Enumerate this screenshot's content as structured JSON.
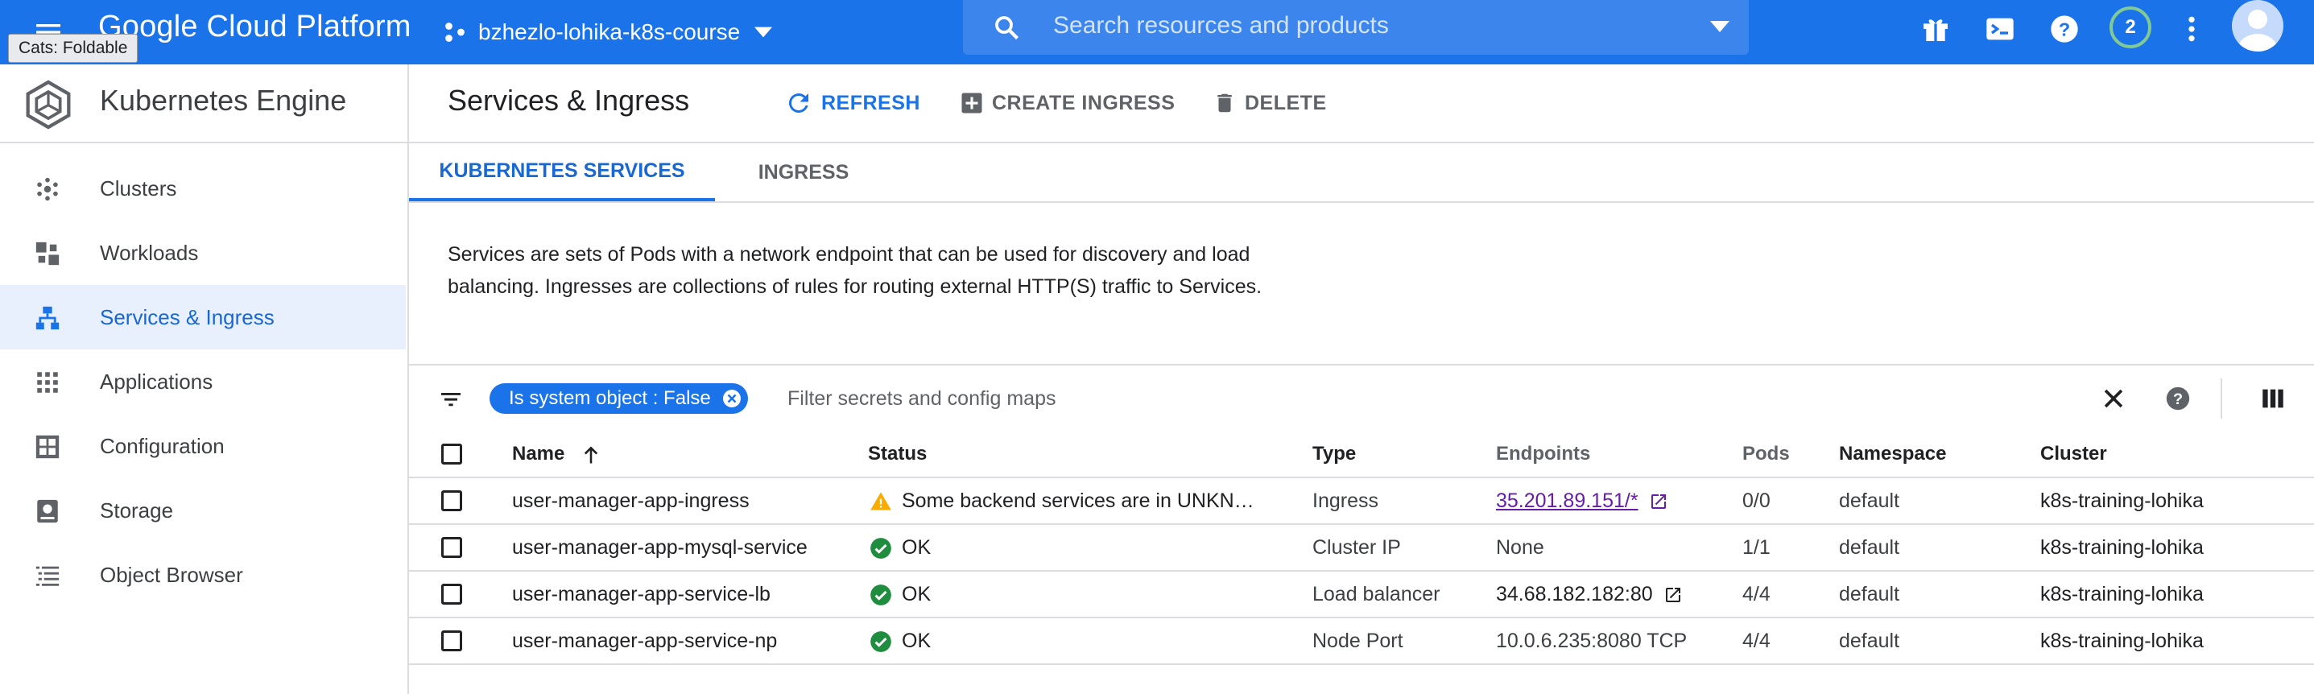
{
  "topbar": {
    "brand": "Google Cloud Platform",
    "project": "bzhezlo-lohika-k8s-course",
    "search_placeholder": "Search resources and products",
    "notification_count": "2",
    "tooltip": "Cats: Foldable",
    "icons": [
      "menu-icon",
      "project-icon",
      "search-icon",
      "gift-icon",
      "cloud-shell-icon",
      "help-icon",
      "more-vert-icon",
      "account-avatar"
    ]
  },
  "sidebar": {
    "product": "Kubernetes Engine",
    "items": [
      {
        "label": "Clusters",
        "icon": "clusters-icon"
      },
      {
        "label": "Workloads",
        "icon": "workloads-icon"
      },
      {
        "label": "Services & Ingress",
        "icon": "services-icon",
        "active": true
      },
      {
        "label": "Applications",
        "icon": "applications-icon"
      },
      {
        "label": "Configuration",
        "icon": "configuration-icon"
      },
      {
        "label": "Storage",
        "icon": "storage-icon"
      },
      {
        "label": "Object Browser",
        "icon": "object-browser-icon"
      }
    ]
  },
  "main": {
    "title": "Services & Ingress",
    "actions": {
      "refresh": "REFRESH",
      "create": "CREATE INGRESS",
      "delete": "DELETE"
    },
    "tabs": [
      {
        "label": "KUBERNETES SERVICES",
        "active": true
      },
      {
        "label": "INGRESS"
      }
    ],
    "description": "Services are sets of Pods with a network endpoint that can be used for discovery and load balancing. Ingresses are collections of rules for routing external HTTP(S) traffic to Services.",
    "filter": {
      "chip": "Is system object : False",
      "placeholder": "Filter secrets and config maps"
    },
    "columns": [
      "Name",
      "Status",
      "Type",
      "Endpoints",
      "Pods",
      "Namespace",
      "Cluster"
    ],
    "rows": [
      {
        "name": "user-manager-app-ingress",
        "status": "Some backend services are in UNKN…",
        "status_kind": "warning",
        "type": "Ingress",
        "endpoints": "35.201.89.151/*",
        "endpoint_link": true,
        "pods": "0/0",
        "namespace": "default",
        "cluster": "k8s-training-lohika"
      },
      {
        "name": "user-manager-app-mysql-service",
        "status": "OK",
        "status_kind": "ok",
        "type": "Cluster IP",
        "endpoints": "None",
        "endpoint_link": false,
        "pods": "1/1",
        "namespace": "default",
        "cluster": "k8s-training-lohika"
      },
      {
        "name": "user-manager-app-service-lb",
        "status": "OK",
        "status_kind": "ok",
        "type": "Load balancer",
        "endpoints": "34.68.182.182:80",
        "endpoint_link": false,
        "endpoint_external": true,
        "pods": "4/4",
        "namespace": "default",
        "cluster": "k8s-training-lohika"
      },
      {
        "name": "user-manager-app-service-np",
        "status": "OK",
        "status_kind": "ok",
        "type": "Node Port",
        "endpoints": "10.0.6.235:8080 TCP",
        "endpoint_link": false,
        "pods": "4/4",
        "namespace": "default",
        "cluster": "k8s-training-lohika"
      }
    ]
  },
  "colors": {
    "primary": "#1a73e8",
    "ok": "#1e8e3e",
    "warning": "#f9ab00",
    "link": "#681da8"
  }
}
